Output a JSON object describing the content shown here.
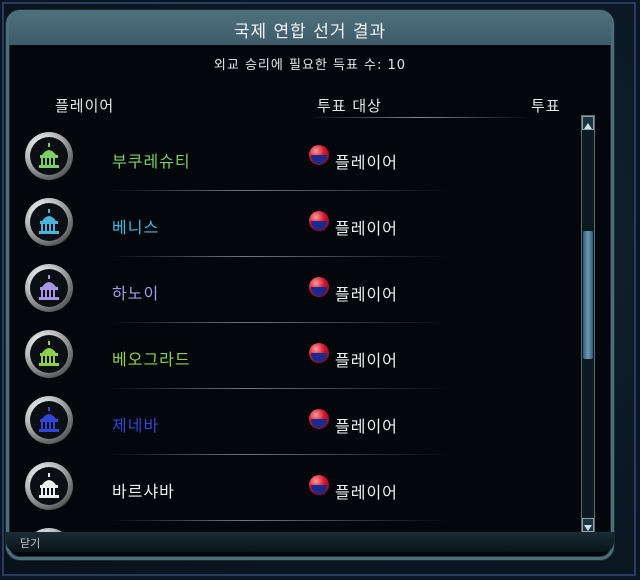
{
  "title": "국제 연합 선거 결과",
  "subtitle": "외교 승리에 필요한 득표 수: 10",
  "columns": {
    "player": "플레이어",
    "target": "투표 대상",
    "votes": "투표"
  },
  "rows": [
    {
      "name": "부쿠레슈티",
      "color": "#7ccf64",
      "target": "플레이어"
    },
    {
      "name": "베니스",
      "color": "#48b6dc",
      "target": "플레이어"
    },
    {
      "name": "하노이",
      "color": "#a896e6",
      "target": "플레이어"
    },
    {
      "name": "베오그라드",
      "color": "#8fd04a",
      "target": "플레이어"
    },
    {
      "name": "제네바",
      "color": "#3046d8",
      "target": "플레이어"
    },
    {
      "name": "바르샤바",
      "color": "#efefef",
      "target": "플레이어"
    }
  ],
  "close_label": "닫기"
}
